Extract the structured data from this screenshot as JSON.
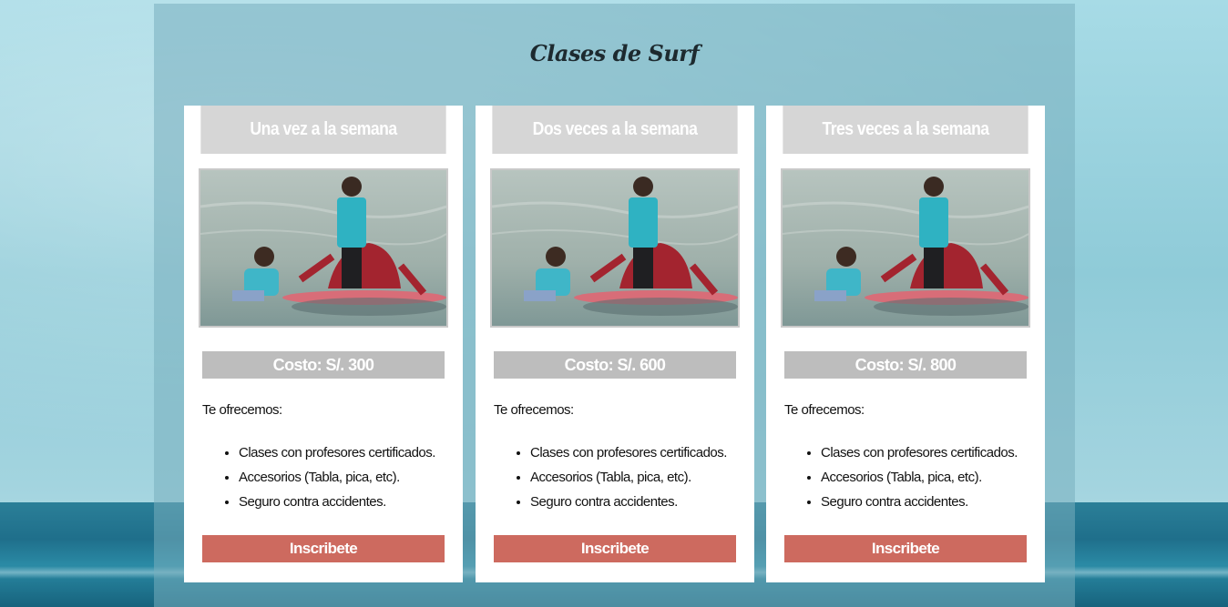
{
  "page": {
    "title": "Clases de Surf"
  },
  "colors": {
    "card_header_bg": "#d6d6d6",
    "price_bg": "#bdbdbd",
    "button_bg": "#cd6a5f",
    "panel_bg": "#78afbe"
  },
  "plans": [
    {
      "title": "Una vez a la semana",
      "price": "Costo: S/. 300",
      "offer_label": "Te ofrecemos:",
      "features": [
        "Clases con profesores certificados.",
        "Accesorios (Tabla, pica, etc).",
        "Seguro contra accidentes."
      ],
      "button_label": "Inscribete"
    },
    {
      "title": "Dos veces a la semana",
      "price": "Costo: S/. 600",
      "offer_label": "Te ofrecemos:",
      "features": [
        "Clases con profesores certificados.",
        "Accesorios (Tabla, pica, etc).",
        "Seguro contra accidentes."
      ],
      "button_label": "Inscribete"
    },
    {
      "title": "Tres veces a la semana",
      "price": "Costo: S/. 800",
      "offer_label": "Te ofrecemos:",
      "features": [
        "Clases con profesores certificados.",
        "Accesorios (Tabla, pica, etc).",
        "Seguro contra accidentes."
      ],
      "button_label": "Inscribete"
    }
  ]
}
